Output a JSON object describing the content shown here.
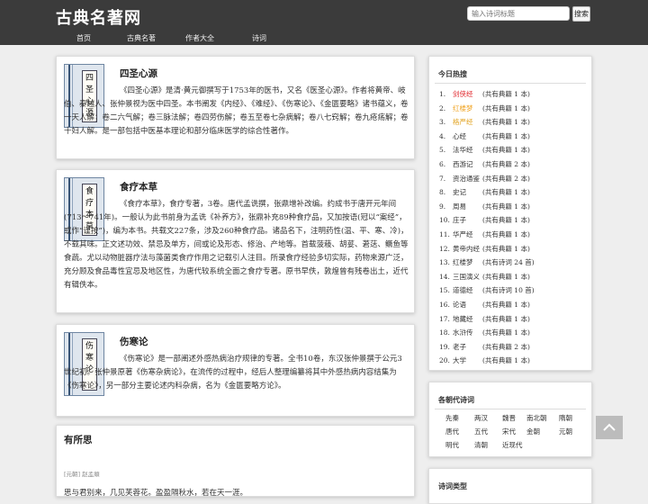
{
  "site": {
    "title": "古典名著网"
  },
  "search": {
    "placeholder": "输入诗词标题",
    "button": "搜索"
  },
  "nav": [
    "首页",
    "古典名著",
    "作者大全",
    "诗词"
  ],
  "books": [
    {
      "cover_text": "四圣心源",
      "title": "四圣心源",
      "desc": "《四圣心源》是清·黄元御撰写于1753年的医书，又名《医圣心源》。作者将黄帝、岐伯、秦越人、张仲景视为医中四圣。本书阐发《内经》、《难经》、《伤寒论》、《金匮要略》诸书蕴义，卷一天人解；卷二六气解；卷三脉法解；卷四劳伤解；卷五至卷七杂病解；卷八七窍解；卷九疮疡解；卷十妇人解。是一部包括中医基本理论和部分临床医学的综合性著作。"
    },
    {
      "cover_text": "食疗本草",
      "title": "食疗本草",
      "desc": "《食疗本草》，食疗专著，3卷。唐代孟诜撰，张鼎增补改编。约成书于唐开元年间(713～741年)。一般认为此书前身为孟诜《补养方》，张鼎补充89种食疗品，又加按语(冠以“案经”，或作“谨按”)，编为本书。共载文227条，涉及260种食疗品。诸品名下，注明药性(温、平、寒、冷)，不载其味。正文述功效、禁忌及单方，间或论及形态、修治、产地等。首载菠薐、胡荽、莙荙、鳜鱼等食蔬。尤以动物脏器疗法与藻菌类食疗作用之记载引人注目。所录食疗经验多切实际，药物来源广泛，充分顾及食品毒性宜忌及地区性，为唐代较系统全面之食疗专著。原书早佚，敦煌曾有残卷出土，近代有辑佚本。"
    },
    {
      "cover_text": "伤寒论",
      "title": "伤寒论",
      "desc": "《伤寒论》是一部阐述外感热病治疗规律的专著。全书10卷，东汉张仲景撰于公元3世纪初。张仲景原著《伤寒杂病论》，在流传的过程中，经后人整理编纂将其中外感热病内容结集为《伤寒论》，另一部分主要论述内科杂病，名为《金匮要略方论》。"
    }
  ],
  "poem": {
    "title": "有所思",
    "meta": "[元朝] 赵孟頫",
    "first_line": "思与君别来，几见芙蓉花。盈盈隔秋水，若在天一涯。"
  },
  "hot": {
    "heading": "今日热搜",
    "items": [
      {
        "rank": "1.",
        "name": "剑侠经",
        "note": "(共有典籍 1 本)",
        "color": "#e0262b"
      },
      {
        "rank": "2.",
        "name": "红楼梦",
        "note": "(共有典籍 1 本)",
        "color": "#f0a21e"
      },
      {
        "rank": "3.",
        "name": "格严经",
        "note": "(共有典籍 1 本)",
        "color": "#e2a321"
      },
      {
        "rank": "4.",
        "name": "心经",
        "note": "(共有典籍 1 本)",
        "color": "#333333"
      },
      {
        "rank": "5.",
        "name": "法华经",
        "note": "(共有典籍 1 本)",
        "color": "#333333"
      },
      {
        "rank": "6.",
        "name": "西游记",
        "note": "(共有典籍 2 本)",
        "color": "#333333"
      },
      {
        "rank": "7.",
        "name": "资治通鉴",
        "note": "(共有典籍 2 本)",
        "color": "#333333"
      },
      {
        "rank": "8.",
        "name": "史记",
        "note": "(共有典籍 1 本)",
        "color": "#333333"
      },
      {
        "rank": "9.",
        "name": "周易",
        "note": "(共有典籍 1 本)",
        "color": "#333333"
      },
      {
        "rank": "10.",
        "name": "庄子",
        "note": "(共有典籍 1 本)",
        "color": "#333333"
      },
      {
        "rank": "11.",
        "name": "华严经",
        "note": "(共有典籍 1 本)",
        "color": "#333333"
      },
      {
        "rank": "12.",
        "name": "黄帝内经",
        "note": "(共有典籍 1 本)",
        "color": "#333333"
      },
      {
        "rank": "13.",
        "name": "红楼梦",
        "note": "(共有诗词 24 首)",
        "color": "#333333"
      },
      {
        "rank": "14.",
        "name": "三国演义",
        "note": "(共有典籍 1 本)",
        "color": "#333333"
      },
      {
        "rank": "15.",
        "name": "道德经",
        "note": "(共有诗词 10 首)",
        "color": "#333333"
      },
      {
        "rank": "16.",
        "name": "论语",
        "note": "(共有典籍 1 本)",
        "color": "#333333"
      },
      {
        "rank": "17.",
        "name": "地藏经",
        "note": "(共有典籍 1 本)",
        "color": "#333333"
      },
      {
        "rank": "18.",
        "name": "水浒传",
        "note": "(共有典籍 1 本)",
        "color": "#333333"
      },
      {
        "rank": "19.",
        "name": "老子",
        "note": "(共有典籍 2 本)",
        "color": "#333333"
      },
      {
        "rank": "20.",
        "name": "大学",
        "note": "(共有典籍 1 本)",
        "color": "#333333"
      }
    ]
  },
  "dynasty": {
    "heading": "各朝代诗词",
    "items": [
      "先秦",
      "两汉",
      "魏晋",
      "南北朝",
      "隋朝",
      "唐代",
      "五代",
      "宋代",
      "金朝",
      "元朝",
      "明代",
      "清朝",
      "近现代"
    ]
  },
  "type_box": {
    "heading": "诗词类型"
  }
}
